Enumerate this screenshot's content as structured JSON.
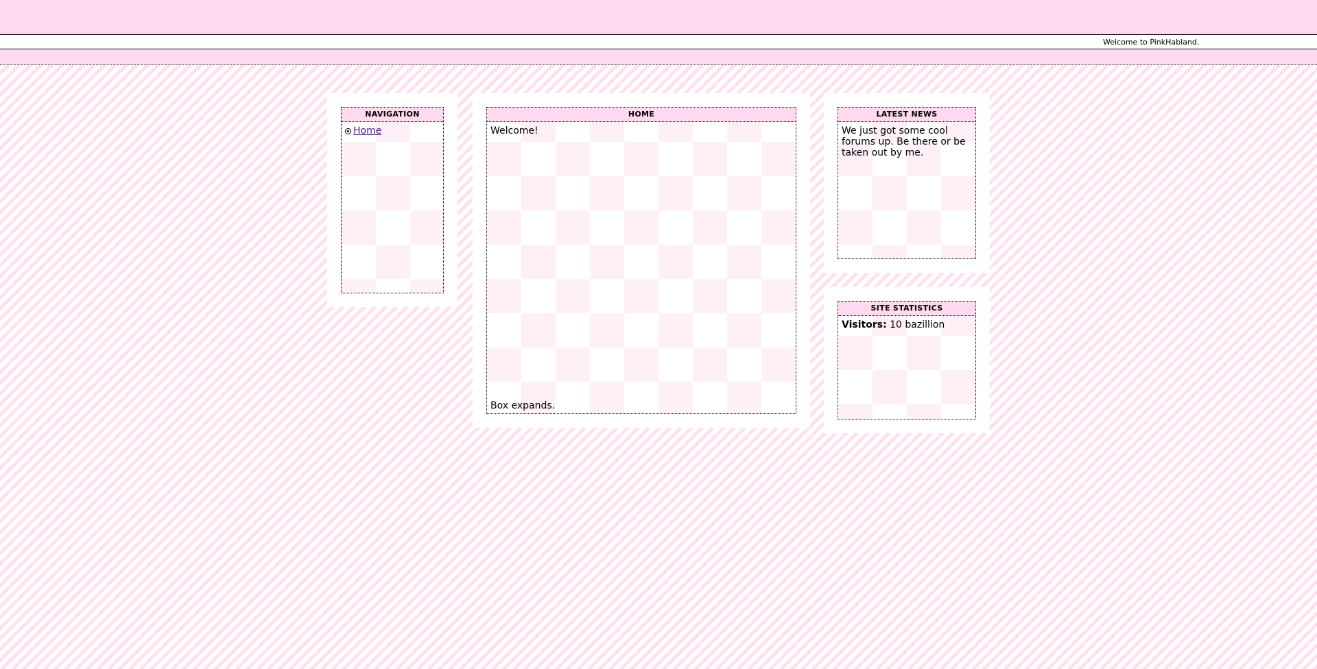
{
  "header": {
    "welcome_text": "Welcome to PinkHabland."
  },
  "navigation": {
    "title": "NAVIGATION",
    "items": [
      {
        "label": "Home",
        "icon": "bullet-circle-icon"
      }
    ]
  },
  "home": {
    "title": "HOME",
    "intro": "Welcome!",
    "footer": "Box expands."
  },
  "news": {
    "title": "LATEST NEWS",
    "text": "We just got some cool forums up. Be there or be taken out by me."
  },
  "stats": {
    "title": "SITE STATISTICS",
    "visitors_label": "Visitors:",
    "visitors_value": "10 bazillion"
  },
  "colors": {
    "pink_band": "#ffd9ef",
    "stripe": "#ffe0f0",
    "checker": "#fff0f7",
    "link": "#551a8b"
  }
}
